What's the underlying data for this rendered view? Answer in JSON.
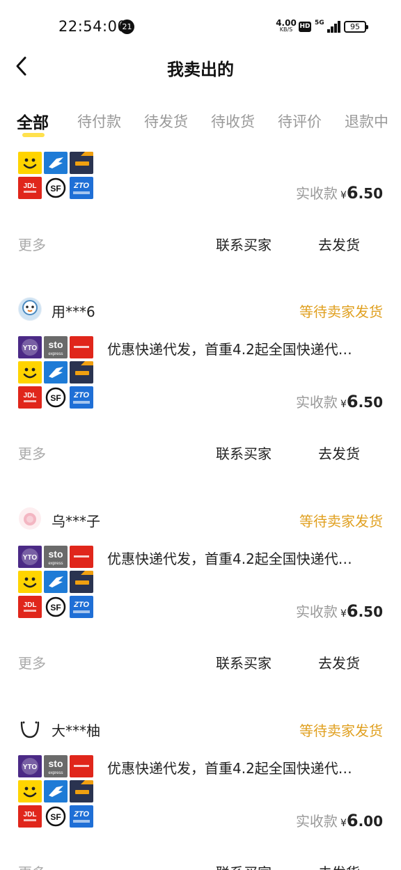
{
  "status_bar": {
    "time": "22:54:00",
    "notification_count": "21",
    "net_speed_value": "4.00",
    "net_speed_unit": "KB/S",
    "hd_label": "HD",
    "network_label": "5G",
    "battery_level": "95"
  },
  "nav": {
    "title": "我卖出的"
  },
  "tabs": [
    {
      "label": "全部",
      "active": true
    },
    {
      "label": "待付款",
      "active": false
    },
    {
      "label": "待发货",
      "active": false
    },
    {
      "label": "待收货",
      "active": false
    },
    {
      "label": "待评价",
      "active": false
    },
    {
      "label": "退款中",
      "active": false
    }
  ],
  "orders": [
    {
      "buyer": "",
      "status": "",
      "product_title": "",
      "price_label": "实收款",
      "currency": "¥",
      "price_int": "6",
      "price_dec": ".50",
      "more_label": "更多",
      "contact_label": "联系买家",
      "ship_label": "去发货"
    },
    {
      "buyer": "用***6",
      "status": "等待卖家发货",
      "product_title": "优惠快递代发，首重4.2起全国快递代…",
      "price_label": "实收款",
      "currency": "¥",
      "price_int": "6",
      "price_dec": ".50",
      "more_label": "更多",
      "contact_label": "联系买家",
      "ship_label": "去发货"
    },
    {
      "buyer": "乌***子",
      "status": "等待卖家发货",
      "product_title": "优惠快递代发，首重4.2起全国快递代…",
      "price_label": "实收款",
      "currency": "¥",
      "price_int": "6",
      "price_dec": ".50",
      "more_label": "更多",
      "contact_label": "联系买家",
      "ship_label": "去发货"
    },
    {
      "buyer": "大***柚",
      "status": "等待卖家发货",
      "product_title": "优惠快递代发，首重4.2起全国快递代…",
      "price_label": "实收款",
      "currency": "¥",
      "price_int": "6",
      "price_dec": ".00",
      "more_label": "更多",
      "contact_label": "联系买家",
      "ship_label": "去发货"
    }
  ],
  "logos": {
    "yto": "YTO",
    "sto": "sto",
    "sto_sub": "express",
    "jd": "JDL",
    "jd_sub": "京东物流",
    "sf": "SF",
    "zto": "ZTO",
    "zto_sub": "中通快递"
  },
  "colors": {
    "accent_yellow": "#ffe14d",
    "status_orange": "#e0a020",
    "muted_gray": "#999999"
  }
}
